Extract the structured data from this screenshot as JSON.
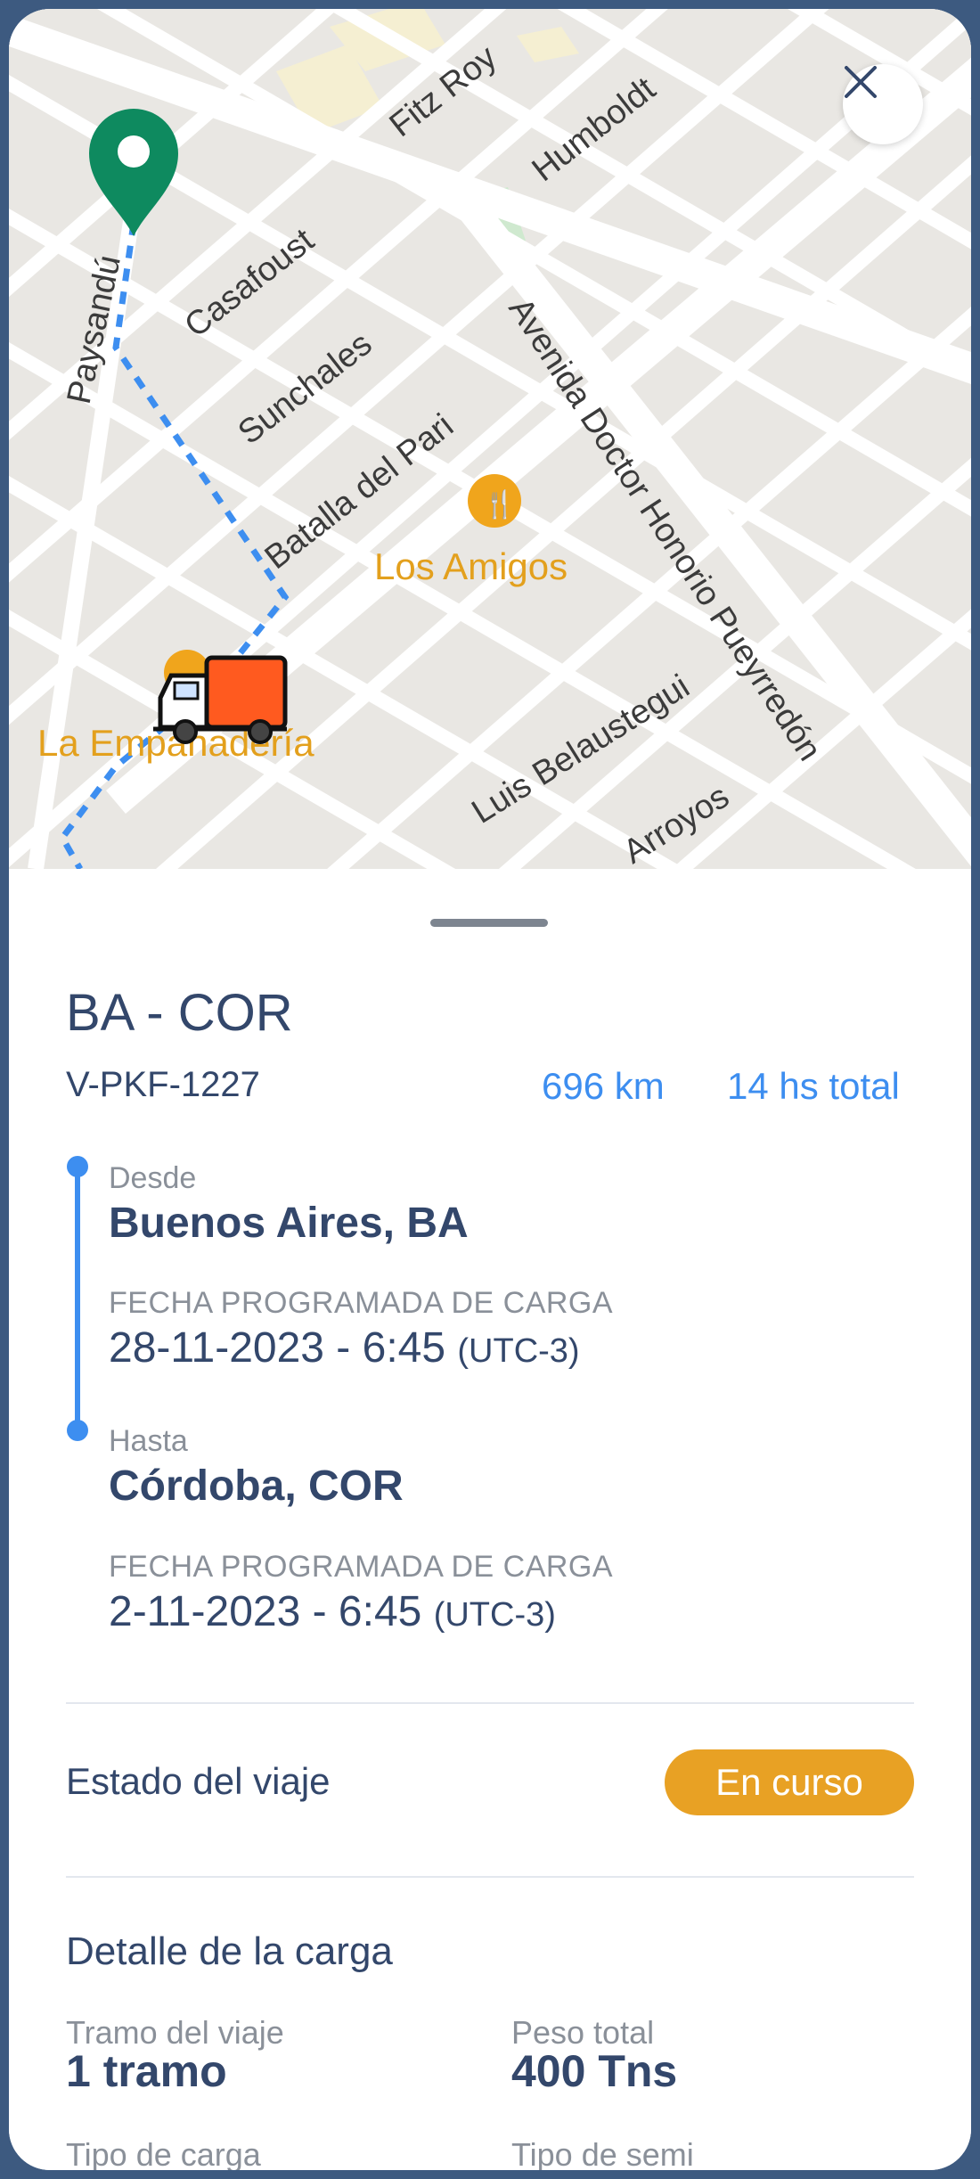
{
  "map": {
    "streets": [
      "Fitz Roy",
      "Humboldt",
      "Casafoust",
      "Paysandú",
      "Sunchales",
      "Batalla del Pari",
      "Avenida Doctor Honorio Pueyrredón",
      "Luis Belaustegui",
      "Arroyos"
    ],
    "places": [
      "Los Amigos",
      "La Empanadería"
    ],
    "route_color": "#3d8ef0",
    "pin_color": "#0e8a5f",
    "truck_color": "#ff5a1f"
  },
  "trip": {
    "route": "BA - COR",
    "vehicle_id": "V-PKF-1227",
    "distance": "696 km",
    "duration": "14 hs total"
  },
  "origin": {
    "label": "Desde",
    "city": "Buenos Aires, BA",
    "date_label": "FECHA PROGRAMADA DE CARGA",
    "date": "28-11-2023 - 6:45",
    "timezone": "(UTC-3)"
  },
  "destination": {
    "label": "Hasta",
    "city": "Córdoba, COR",
    "date_label": "FECHA PROGRAMADA DE CARGA",
    "date": "2-11-2023 - 6:45",
    "timezone": "(UTC-3)"
  },
  "status": {
    "label": "Estado del viaje",
    "value": "En curso",
    "color": "#e8a124"
  },
  "cargo": {
    "title": "Detalle de la carga",
    "segments_label": "Tramo del viaje",
    "segments_value": "1 tramo",
    "weight_label": "Peso total",
    "weight_value": "400 Tns",
    "type_label": "Tipo de carga",
    "semi_label": "Tipo de semi"
  }
}
